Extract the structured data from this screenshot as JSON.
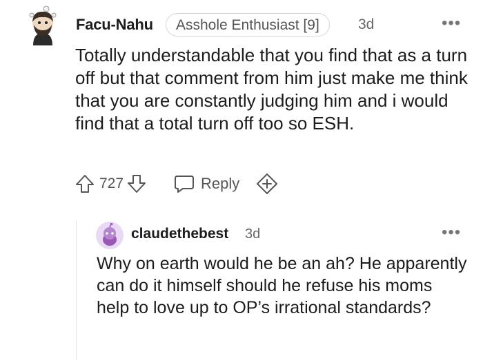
{
  "comment": {
    "username": "Facu-Nahu",
    "flair": "Asshole Enthusiast [9]",
    "time": "3d",
    "more": "•••",
    "body": "Totally understandable that you find that as a turn off but that comment from him just make me think that you are constantly judging him and i would find that a total turn off too so ESH.",
    "score": "727",
    "reply_label": "Reply"
  },
  "reply": {
    "username": "claudethebest",
    "time": "3d",
    "more": "•••",
    "body": "Why on earth would he be an ah? He apparently can do it himself should he refuse his moms help to love up to OP’s irrational standards?"
  },
  "colors": {
    "text": "#1c1c1c",
    "muted": "#555555",
    "avatar2_bg": "#e9d9f5",
    "avatar2_fg": "#9b59b6"
  },
  "icons": [
    "avatar-icon",
    "upvote-icon",
    "downvote-icon",
    "reply-icon",
    "award-icon",
    "more-options-icon"
  ]
}
